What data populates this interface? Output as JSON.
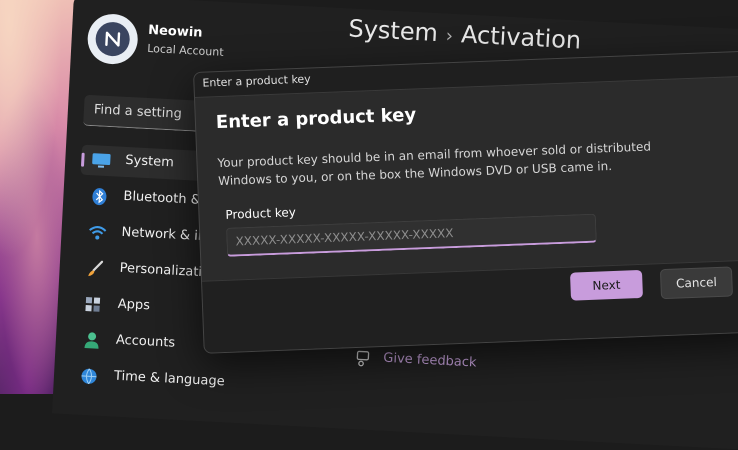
{
  "window": {
    "breadcrumb": [
      "System",
      "Activation"
    ],
    "breadcrumb_separator": "›"
  },
  "user": {
    "name": "Neowin",
    "account_type": "Local Account"
  },
  "search": {
    "placeholder": "Find a setting"
  },
  "sidebar": {
    "items": [
      {
        "label": "System",
        "icon": "monitor-icon",
        "active": true
      },
      {
        "label": "Bluetooth &",
        "icon": "bluetooth-icon"
      },
      {
        "label": "Network & in",
        "icon": "wifi-icon"
      },
      {
        "label": "Personalizati",
        "icon": "brush-icon"
      },
      {
        "label": "Apps",
        "icon": "apps-icon"
      },
      {
        "label": "Accounts",
        "icon": "person-icon"
      },
      {
        "label": "Time & language",
        "icon": "globe-clock-icon"
      }
    ]
  },
  "feedback": {
    "label": "Give feedback",
    "icon": "feedback-icon"
  },
  "dialog": {
    "window_title": "Enter a product key",
    "heading": "Enter a product key",
    "description": "Your product key should be in an email from whoever sold or distributed Windows to you, or on the box the Windows DVD or USB came in.",
    "field_label": "Product key",
    "field_placeholder": "XXXXX-XXXXX-XXXXX-XXXXX-XXXXX",
    "field_value": "",
    "next_label": "Next",
    "cancel_label": "Cancel"
  },
  "colors": {
    "accent": "#c89cdc",
    "background": "#202020",
    "dialog_background": "#2b2b2b"
  }
}
